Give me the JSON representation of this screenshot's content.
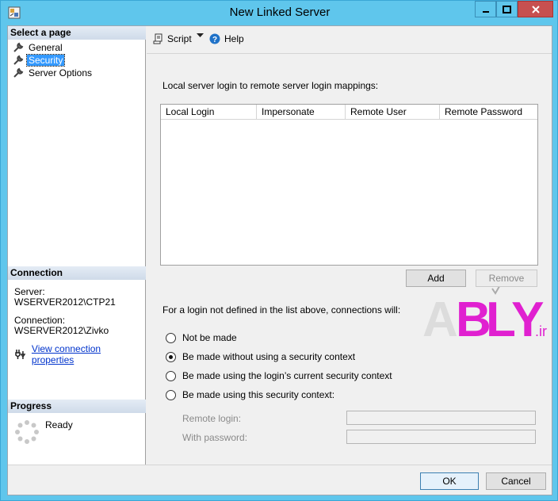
{
  "window": {
    "title": "New Linked Server",
    "colors": {
      "titlebar": "#5fc6ec",
      "close": "#c75050",
      "selection": "#3399ff",
      "link": "#0033cc"
    }
  },
  "sidebar": {
    "select_page_header": "Select a page",
    "pages": [
      {
        "label": "General",
        "icon": "wrench-icon",
        "selected": false
      },
      {
        "label": "Security",
        "icon": "wrench-icon",
        "selected": true
      },
      {
        "label": "Server Options",
        "icon": "wrench-icon",
        "selected": false
      }
    ],
    "connection": {
      "header": "Connection",
      "server_label": "Server:",
      "server_value": "WSERVER2012\\CTP21",
      "connection_label": "Connection:",
      "connection_value": "WSERVER2012\\Zivko",
      "link_text": "View connection properties"
    },
    "progress": {
      "header": "Progress",
      "status": "Ready"
    }
  },
  "toolbar": {
    "script_label": "Script",
    "help_label": "Help"
  },
  "security": {
    "mappings_label": "Local server login to remote server login mappings:",
    "columns": [
      "Local Login",
      "Impersonate",
      "Remote User",
      "Remote Password"
    ],
    "rows": [],
    "add_label": "Add",
    "remove_label": "Remove",
    "undefined_label": "For a login not defined in the list above, connections will:",
    "options": [
      {
        "label": "Not be made",
        "checked": false
      },
      {
        "label": "Be made without using a security context",
        "checked": true
      },
      {
        "label": "Be made using the login’s current security context",
        "checked": false
      },
      {
        "label": "Be made using this security context:",
        "checked": false
      }
    ],
    "remote_login_label": "Remote login:",
    "remote_login_value": "",
    "password_label": "With password:",
    "password_value": ""
  },
  "footer": {
    "ok_label": "OK",
    "cancel_label": "Cancel"
  },
  "watermark": {
    "brand": "ABLY",
    "suffix": ".ir"
  }
}
